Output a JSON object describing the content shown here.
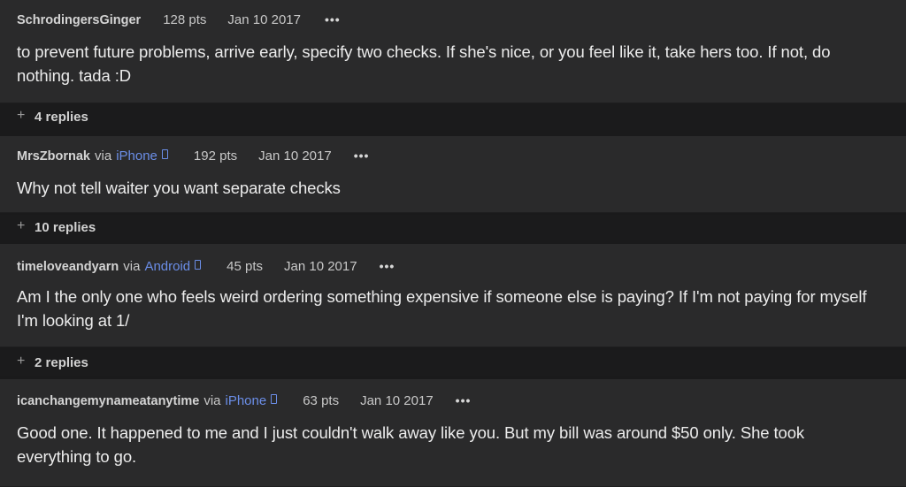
{
  "comments": [
    {
      "author": "SchrodingersGinger",
      "via": "",
      "device": "",
      "points": "128 pts",
      "date": "Jan 10 2017",
      "more": "•••",
      "body": "to prevent future problems, arrive early, specify two checks. If she's nice, or you feel like it, take hers too. If not, do nothing. tada :D",
      "replies": "4 replies"
    },
    {
      "author": "MrsZbornak",
      "via": "via",
      "device": "iPhone",
      "points": "192 pts",
      "date": "Jan 10 2017",
      "more": "•••",
      "body": "Why not tell waiter you want separate checks",
      "replies": "10 replies"
    },
    {
      "author": "timeloveandyarn",
      "via": "via",
      "device": "Android",
      "points": "45 pts",
      "date": "Jan 10 2017",
      "more": "•••",
      "body": "Am I the only one who feels weird ordering something expensive if someone else is paying? If I'm not paying for myself I'm looking at 1/",
      "replies": "2 replies"
    },
    {
      "author": "icanchangemynameatanytime",
      "via": "via",
      "device": "iPhone",
      "points": "63 pts",
      "date": "Jan 10 2017",
      "more": "•••",
      "body": "Good one. It happened to me and I just couldn't walk away like you. But my bill was around $50 only. She took everything to go.",
      "replies": ""
    }
  ],
  "icons": {
    "expand": "plus-icon",
    "more": "more-options-icon",
    "device": "phone-icon"
  },
  "colors": {
    "background": "#1a1a1b",
    "card": "#2a2a2b",
    "link": "#6b8ee8",
    "text": "#ececec"
  }
}
